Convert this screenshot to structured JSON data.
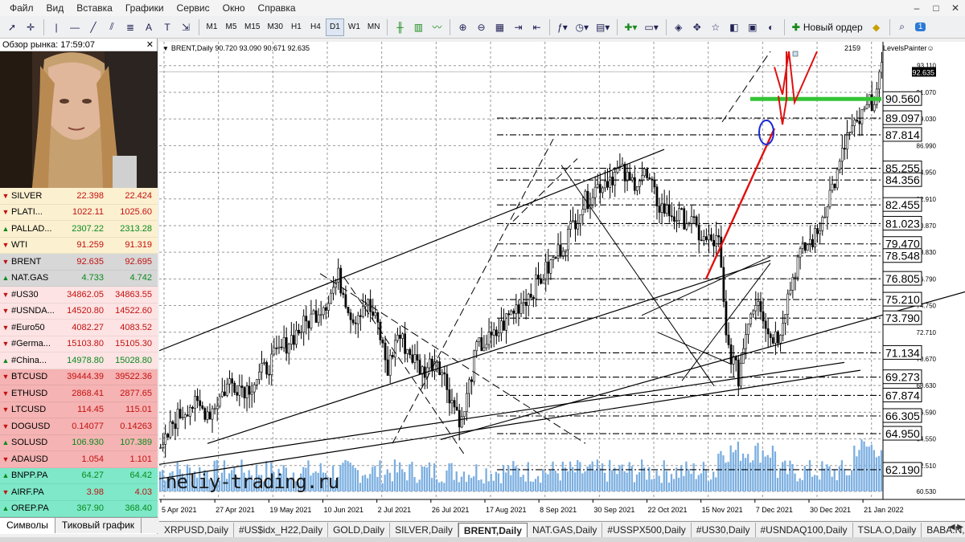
{
  "menu": [
    "Файл",
    "Вид",
    "Вставка",
    "Графики",
    "Сервис",
    "Окно",
    "Справка"
  ],
  "window_controls": [
    "–",
    "□",
    "✕"
  ],
  "toolbar": {
    "timeframes": [
      "M1",
      "M5",
      "M15",
      "M30",
      "H1",
      "H4",
      "D1",
      "W1",
      "MN"
    ],
    "active_timeframe": "D1",
    "new_order": "Новый ордер",
    "notification_badge": "1"
  },
  "market_watch": {
    "title": "Обзор рынка: 17:59:07",
    "close": "✕",
    "symbols": [
      {
        "name": "SILVER",
        "bid": "22.398",
        "ask": "22.424",
        "dir": "dn",
        "bg": "#fbf0d0"
      },
      {
        "name": "PLATI...",
        "bid": "1022.11",
        "ask": "1025.60",
        "dir": "dn",
        "bg": "#fbf0d0"
      },
      {
        "name": "PALLAD...",
        "bid": "2307.22",
        "ask": "2313.28",
        "dir": "up",
        "bg": "#fbf0d0"
      },
      {
        "name": "WTI",
        "bid": "91.259",
        "ask": "91.319",
        "dir": "dn",
        "bg": "#fbf0d0"
      },
      {
        "name": "BRENT",
        "bid": "92.635",
        "ask": "92.695",
        "dir": "dn",
        "bg": "#d7d7d7"
      },
      {
        "name": "NAT.GAS",
        "bid": "4.733",
        "ask": "4.742",
        "dir": "up",
        "bg": "#d7d7d7"
      },
      {
        "name": "#US30",
        "bid": "34862.05",
        "ask": "34863.55",
        "dir": "dn",
        "bg": "#fde3e3"
      },
      {
        "name": "#USNDA...",
        "bid": "14520.80",
        "ask": "14522.60",
        "dir": "dn",
        "bg": "#fde3e3"
      },
      {
        "name": "#Euro50",
        "bid": "4082.27",
        "ask": "4083.52",
        "dir": "dn",
        "bg": "#fde3e3"
      },
      {
        "name": "#Germa...",
        "bid": "15103.80",
        "ask": "15105.30",
        "dir": "dn",
        "bg": "#fde3e3"
      },
      {
        "name": "#China...",
        "bid": "14978.80",
        "ask": "15028.80",
        "dir": "up",
        "bg": "#fde3e3"
      },
      {
        "name": "BTCUSD",
        "bid": "39444.39",
        "ask": "39522.36",
        "dir": "dn",
        "bg": "#f5b3b3"
      },
      {
        "name": "ETHUSD",
        "bid": "2868.41",
        "ask": "2877.65",
        "dir": "dn",
        "bg": "#f5b3b3"
      },
      {
        "name": "LTCUSD",
        "bid": "114.45",
        "ask": "115.01",
        "dir": "dn",
        "bg": "#f5b3b3"
      },
      {
        "name": "DOGUSD",
        "bid": "0.14077",
        "ask": "0.14263",
        "dir": "dn",
        "bg": "#f5b3b3"
      },
      {
        "name": "SOLUSD",
        "bid": "106.930",
        "ask": "107.389",
        "dir": "up",
        "bg": "#f5b3b3"
      },
      {
        "name": "ADAUSD",
        "bid": "1.054",
        "ask": "1.101",
        "dir": "dn",
        "bg": "#f5b3b3"
      },
      {
        "name": "BNPP.PA",
        "bid": "64.27",
        "ask": "64.42",
        "dir": "up",
        "bg": "#7ee8c8"
      },
      {
        "name": "AIRF.PA",
        "bid": "3.98",
        "ask": "4.03",
        "dir": "dn",
        "bg": "#7ee8c8"
      },
      {
        "name": "OREP.PA",
        "bid": "367.90",
        "ask": "368.40",
        "dir": "up",
        "bg": "#7ee8c8"
      }
    ],
    "tabs": [
      "Символы",
      "Тиковый график"
    ]
  },
  "chart": {
    "header": "BRENT,Daily  90.720 93.090 90.671 92.635",
    "header_right": "2159",
    "indicator": "LevelsPainter☺",
    "current_price": "92.635",
    "watermark": "neliy-trading.ru",
    "price_labels": [
      "93.110",
      "91.070",
      "89.030",
      "86.990",
      "84.950",
      "82.910",
      "80.870",
      "78.830",
      "76.790",
      "74.750",
      "72.710",
      "70.670",
      "68.630",
      "66.590",
      "64.550",
      "62.510",
      "60.530"
    ],
    "levels": [
      "90.560",
      "89.097",
      "87.814",
      "85.255",
      "84.356",
      "82.455",
      "81.023",
      "79.470",
      "78.548",
      "76.805",
      "75.210",
      "73.790",
      "71.134",
      "69.273",
      "67.874",
      "66.305",
      "64.950",
      "62.190"
    ],
    "dates": [
      "5 Apr 2021",
      "27 Apr 2021",
      "19 May 2021",
      "10 Jun 2021",
      "2 Jul 2021",
      "26 Jul 2021",
      "17 Aug 2021",
      "8 Sep 2021",
      "30 Sep 2021",
      "22 Oct 2021",
      "15 Nov 2021",
      "7 Dec 2021",
      "30 Dec 2021",
      "21 Jan 2022"
    ]
  },
  "chart_tabs": [
    "XRPUSD,Daily",
    "#US$idx_H22,Daily",
    "GOLD,Daily",
    "SILVER,Daily",
    "BRENT,Daily",
    "NAT.GAS,Daily",
    "#USSPX500,Daily",
    "#US30,Daily",
    "#USNDAQ100,Daily",
    "TSLA.O,Daily",
    "BABA.N,Daily"
  ],
  "active_chart_tab": "BRENT,Daily",
  "chart_data": {
    "type": "candlestick",
    "title": "BRENT,Daily",
    "ohlc_last": {
      "open": 90.72,
      "high": 93.09,
      "low": 90.671,
      "close": 92.635
    },
    "ylim": [
      60.53,
      94.2
    ],
    "x_ticks": [
      "5 Apr 2021",
      "27 Apr 2021",
      "19 May 2021",
      "10 Jun 2021",
      "2 Jul 2021",
      "26 Jul 2021",
      "17 Aug 2021",
      "8 Sep 2021",
      "30 Sep 2021",
      "22 Oct 2021",
      "15 Nov 2021",
      "7 Dec 2021",
      "30 Dec 2021",
      "21 Jan 2022"
    ],
    "y_ticks": [
      93.11,
      91.07,
      89.03,
      86.99,
      84.95,
      82.91,
      80.87,
      78.83,
      76.79,
      74.75,
      72.71,
      70.67,
      68.63,
      66.59,
      64.55,
      62.51,
      60.53
    ],
    "horizontal_levels": [
      90.56,
      89.097,
      87.814,
      85.255,
      84.356,
      82.455,
      81.023,
      79.47,
      78.548,
      76.805,
      75.21,
      73.79,
      71.134,
      69.273,
      67.874,
      66.305,
      64.95,
      62.19
    ],
    "close_waypoints": [
      [
        0,
        63.2
      ],
      [
        5,
        65.8
      ],
      [
        12,
        67.2
      ],
      [
        20,
        66.6
      ],
      [
        28,
        68.9
      ],
      [
        35,
        68.4
      ],
      [
        42,
        69.8
      ],
      [
        52,
        72.1
      ],
      [
        60,
        73.6
      ],
      [
        68,
        75.3
      ],
      [
        72,
        76.9
      ],
      [
        78,
        73.7
      ],
      [
        83,
        75.1
      ],
      [
        88,
        73.2
      ],
      [
        92,
        69.8
      ],
      [
        96,
        72.6
      ],
      [
        100,
        71.4
      ],
      [
        106,
        69.7
      ],
      [
        112,
        70.8
      ],
      [
        118,
        67.5
      ],
      [
        122,
        65.8
      ],
      [
        128,
        71.5
      ],
      [
        135,
        72.3
      ],
      [
        142,
        74.2
      ],
      [
        150,
        75.8
      ],
      [
        158,
        77.9
      ],
      [
        164,
        79.8
      ],
      [
        170,
        82.2
      ],
      [
        176,
        83.7
      ],
      [
        182,
        84.6
      ],
      [
        186,
        85.1
      ],
      [
        190,
        84.1
      ],
      [
        196,
        84.8
      ],
      [
        202,
        82.4
      ],
      [
        208,
        81.6
      ],
      [
        214,
        81.3
      ],
      [
        220,
        79.7
      ],
      [
        226,
        79.6
      ],
      [
        229,
        72.2
      ],
      [
        234,
        69.2
      ],
      [
        238,
        73.9
      ],
      [
        242,
        75.6
      ],
      [
        246,
        72.6
      ],
      [
        250,
        72.4
      ],
      [
        254,
        75.5
      ],
      [
        258,
        78.3
      ],
      [
        262,
        79.4
      ],
      [
        266,
        80.2
      ],
      [
        270,
        82.9
      ],
      [
        274,
        84.7
      ],
      [
        278,
        87.7
      ],
      [
        282,
        88.5
      ],
      [
        286,
        89.8
      ],
      [
        290,
        91.1
      ],
      [
        292,
        92.6
      ]
    ],
    "volume_note": "volume bars shown below candles"
  }
}
